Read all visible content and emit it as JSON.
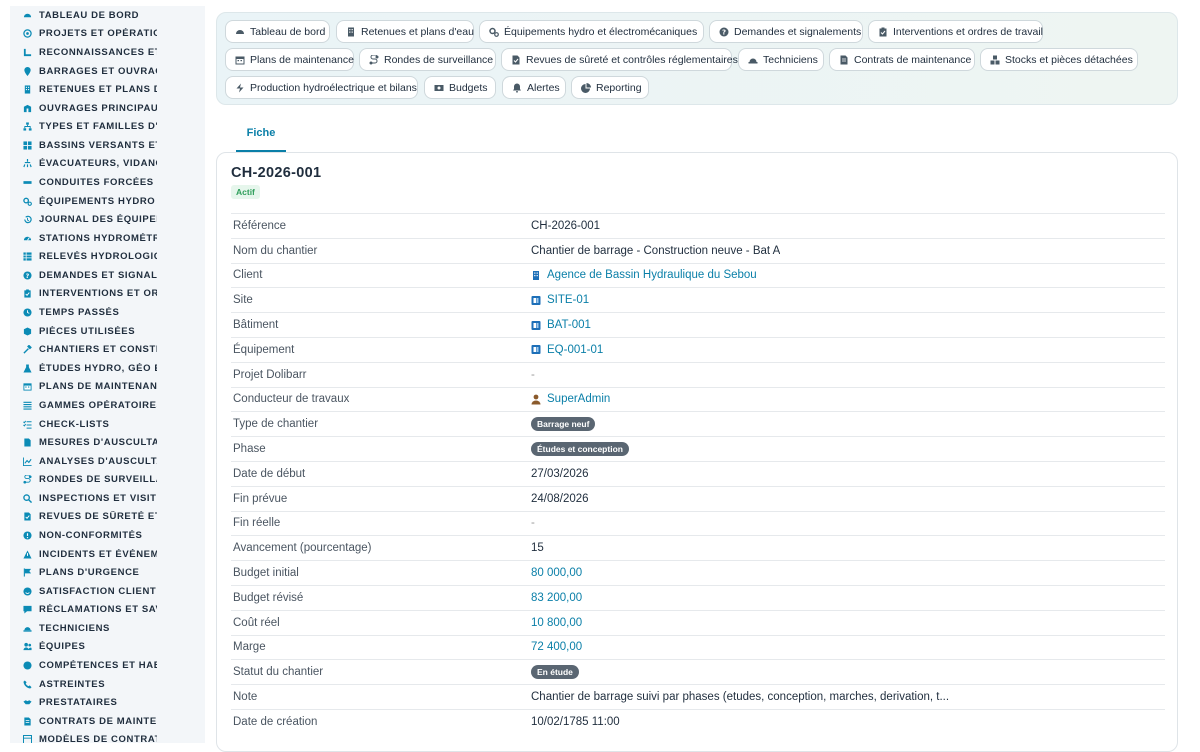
{
  "sidebar": {
    "items": [
      {
        "label": "TABLEAU DE BORD",
        "icon": "dashboard-icon"
      },
      {
        "label": "PROJETS ET OPÉRATION",
        "icon": "target-icon"
      },
      {
        "label": "RECONNAISSANCES ET V",
        "icon": "ruler-icon"
      },
      {
        "label": "BARRAGES ET OUVRAGE",
        "icon": "map-pin-icon"
      },
      {
        "label": "RETENUES ET PLANS D'E",
        "icon": "building-icon"
      },
      {
        "label": "OUVRAGES PRINCIPAUX",
        "icon": "structure-icon"
      },
      {
        "label": "TYPES ET FAMILLES D'OU",
        "icon": "hierarchy-icon"
      },
      {
        "label": "BASSINS VERSANTS ET A",
        "icon": "grid-icon"
      },
      {
        "label": "ÉVACUATEURS, VIDANGE",
        "icon": "shower-icon"
      },
      {
        "label": "CONDUITES FORCÉES ET",
        "icon": "pipe-icon"
      },
      {
        "label": "ÉQUIPEMENTS HYDRO ET",
        "icon": "cogs-icon"
      },
      {
        "label": "JOURNAL DES ÉQUIPEME",
        "icon": "history-icon"
      },
      {
        "label": "STATIONS HYDROMÉTRIC",
        "icon": "gauge-icon"
      },
      {
        "label": "RELEVÉS HYDROLOGIQU",
        "icon": "table-icon"
      },
      {
        "label": "DEMANDES ET SIGNALEM",
        "icon": "question-icon"
      },
      {
        "label": "INTERVENTIONS ET ORDI",
        "icon": "clipboard-icon"
      },
      {
        "label": "TEMPS PASSÉS",
        "icon": "clock-icon"
      },
      {
        "label": "PIÈCES UTILISÉES",
        "icon": "cube-icon"
      },
      {
        "label": "CHANTIERS ET CONSTRU",
        "icon": "hammer-icon"
      },
      {
        "label": "ÉTUDES HYDRO, GÉO ET",
        "icon": "flask-icon"
      },
      {
        "label": "PLANS DE MAINTENANCE",
        "icon": "calendar-icon"
      },
      {
        "label": "GAMMES OPÉRATOIRES",
        "icon": "list-icon"
      },
      {
        "label": "CHECK-LISTS",
        "icon": "checklist-icon"
      },
      {
        "label": "MESURES D'AUSCULTATI",
        "icon": "document-icon"
      },
      {
        "label": "ANALYSES D'AUSCULTAT",
        "icon": "chart-icon"
      },
      {
        "label": "RONDES DE SURVEILLAN",
        "icon": "route-icon"
      },
      {
        "label": "INSPECTIONS ET VISITES",
        "icon": "search-icon"
      },
      {
        "label": "REVUES DE SÛRETÉ ET C",
        "icon": "file-check-icon"
      },
      {
        "label": "NON-CONFORMITÉS",
        "icon": "alert-circle-icon"
      },
      {
        "label": "INCIDENTS ET ÉVÉNEMEI",
        "icon": "warning-icon"
      },
      {
        "label": "PLANS D'URGENCE",
        "icon": "flag-icon"
      },
      {
        "label": "SATISFACTION CLIENT",
        "icon": "smile-icon"
      },
      {
        "label": "RÉCLAMATIONS ET SAV",
        "icon": "comment-icon"
      },
      {
        "label": "TECHNICIENS",
        "icon": "hard-hat-icon"
      },
      {
        "label": "ÉQUIPES",
        "icon": "users-icon"
      },
      {
        "label": "COMPÉTENCES ET HABIL",
        "icon": "badge-icon"
      },
      {
        "label": "ASTREINTES",
        "icon": "phone-icon"
      },
      {
        "label": "PRESTATAIRES",
        "icon": "handshake-icon"
      },
      {
        "label": "CONTRATS DE MAINTENA",
        "icon": "contract-icon"
      },
      {
        "label": "MODÈLES DE CONTRATS",
        "icon": "template-icon"
      }
    ]
  },
  "topnav": {
    "tabs": [
      {
        "label": "Tableau de bord",
        "icon": "dashboard-icon"
      },
      {
        "label": "Retenues et plans d'eau",
        "icon": "building-icon"
      },
      {
        "label": "Équipements hydro et électromécaniques",
        "icon": "cogs-icon"
      },
      {
        "label": "Demandes et signalements",
        "icon": "question-icon"
      },
      {
        "label": "Interventions et ordres de travail",
        "icon": "clipboard-icon"
      },
      {
        "label": "Plans de maintenance",
        "icon": "calendar-icon"
      },
      {
        "label": "Rondes de surveillance",
        "icon": "route-icon"
      },
      {
        "label": "Revues de sûreté et contrôles réglementaires",
        "icon": "file-check-icon"
      },
      {
        "label": "Techniciens",
        "icon": "hard-hat-icon"
      },
      {
        "label": "Contrats de maintenance",
        "icon": "contract-icon"
      },
      {
        "label": "Stocks et pièces détachées",
        "icon": "cubes-icon"
      },
      {
        "label": "Production hydroélectrique et bilans",
        "icon": "bolt-icon"
      },
      {
        "label": "Budgets",
        "icon": "money-icon"
      },
      {
        "label": "Alertes",
        "icon": "bell-icon"
      },
      {
        "label": "Reporting",
        "icon": "pie-icon"
      }
    ]
  },
  "fiche_tab": "Fiche",
  "record": {
    "title": "CH-2026-001",
    "status": "Actif",
    "fields": [
      {
        "label": "Référence",
        "value": "CH-2026-001",
        "kind": "text"
      },
      {
        "label": "Nom du chantier",
        "value": "Chantier de barrage - Construction neuve - Bat A",
        "kind": "text"
      },
      {
        "label": "Client",
        "value": "Agence de Bassin Hydraulique du Sebou",
        "kind": "link",
        "icon": "building-icon"
      },
      {
        "label": "Site",
        "value": "SITE-01",
        "kind": "link",
        "icon": "object-icon"
      },
      {
        "label": "Bâtiment",
        "value": "BAT-001",
        "kind": "link",
        "icon": "object-icon"
      },
      {
        "label": "Équipement",
        "value": "EQ-001-01",
        "kind": "link",
        "icon": "object-icon"
      },
      {
        "label": "Projet Dolibarr",
        "value": "-",
        "kind": "muted"
      },
      {
        "label": "Conducteur de travaux",
        "value": "SuperAdmin",
        "kind": "link",
        "icon": "user-icon"
      },
      {
        "label": "Type de chantier",
        "value": "Barrage neuf",
        "kind": "badge"
      },
      {
        "label": "Phase",
        "value": "Études et conception",
        "kind": "badge"
      },
      {
        "label": "Date de début",
        "value": "27/03/2026",
        "kind": "text"
      },
      {
        "label": "Fin prévue",
        "value": "24/08/2026",
        "kind": "text"
      },
      {
        "label": "Fin réelle",
        "value": "-",
        "kind": "muted"
      },
      {
        "label": "Avancement (pourcentage)",
        "value": "15",
        "kind": "text"
      },
      {
        "label": "Budget initial",
        "value": "80 000,00",
        "kind": "amount"
      },
      {
        "label": "Budget révisé",
        "value": "83 200,00",
        "kind": "amount"
      },
      {
        "label": "Coût réel",
        "value": "10 800,00",
        "kind": "amount"
      },
      {
        "label": "Marge",
        "value": "72 400,00",
        "kind": "amount"
      },
      {
        "label": "Statut du chantier",
        "value": "En étude",
        "kind": "badge"
      },
      {
        "label": "Note",
        "value": "Chantier de barrage suivi par phases (etudes, conception, marches, derivation, t...",
        "kind": "text"
      },
      {
        "label": "Date de création",
        "value": "10/02/1785 11:00",
        "kind": "text"
      }
    ]
  },
  "colors": {
    "accent": "#0a7fa8",
    "sidebar_icon": "#0b8bb5",
    "status_green": "#2e9e5a",
    "badge_gray": "#5a6672"
  }
}
